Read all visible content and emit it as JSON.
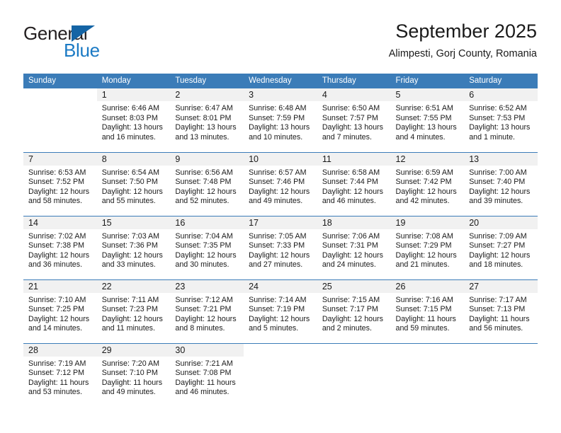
{
  "brand": {
    "line1": "General",
    "line2": "Blue",
    "triangle_color": "#1464a5",
    "blue_text_color": "#1b7ac4"
  },
  "header": {
    "title": "September 2025",
    "subtitle": "Alimpesti, Gorj County, Romania"
  },
  "theme": {
    "header_row_bg": "#3b7cb8",
    "daynum_bg": "#f1f1f1",
    "row_divider": "#3b7cb8",
    "text": "#1a1a1a"
  },
  "weekday_headers": [
    "Sunday",
    "Monday",
    "Tuesday",
    "Wednesday",
    "Thursday",
    "Friday",
    "Saturday"
  ],
  "labels": {
    "sunrise_prefix": "Sunrise:",
    "sunset_prefix": "Sunset:",
    "daylight_prefix": "Daylight:"
  },
  "weeks": [
    [
      {
        "day": "",
        "sunrise": "",
        "sunset": "",
        "daylight_line1": "",
        "daylight_line2": "",
        "blank": true
      },
      {
        "day": "1",
        "sunrise": "Sunrise: 6:46 AM",
        "sunset": "Sunset: 8:03 PM",
        "daylight_line1": "Daylight: 13 hours",
        "daylight_line2": "and 16 minutes."
      },
      {
        "day": "2",
        "sunrise": "Sunrise: 6:47 AM",
        "sunset": "Sunset: 8:01 PM",
        "daylight_line1": "Daylight: 13 hours",
        "daylight_line2": "and 13 minutes."
      },
      {
        "day": "3",
        "sunrise": "Sunrise: 6:48 AM",
        "sunset": "Sunset: 7:59 PM",
        "daylight_line1": "Daylight: 13 hours",
        "daylight_line2": "and 10 minutes."
      },
      {
        "day": "4",
        "sunrise": "Sunrise: 6:50 AM",
        "sunset": "Sunset: 7:57 PM",
        "daylight_line1": "Daylight: 13 hours",
        "daylight_line2": "and 7 minutes."
      },
      {
        "day": "5",
        "sunrise": "Sunrise: 6:51 AM",
        "sunset": "Sunset: 7:55 PM",
        "daylight_line1": "Daylight: 13 hours",
        "daylight_line2": "and 4 minutes."
      },
      {
        "day": "6",
        "sunrise": "Sunrise: 6:52 AM",
        "sunset": "Sunset: 7:53 PM",
        "daylight_line1": "Daylight: 13 hours",
        "daylight_line2": "and 1 minute."
      }
    ],
    [
      {
        "day": "7",
        "sunrise": "Sunrise: 6:53 AM",
        "sunset": "Sunset: 7:52 PM",
        "daylight_line1": "Daylight: 12 hours",
        "daylight_line2": "and 58 minutes."
      },
      {
        "day": "8",
        "sunrise": "Sunrise: 6:54 AM",
        "sunset": "Sunset: 7:50 PM",
        "daylight_line1": "Daylight: 12 hours",
        "daylight_line2": "and 55 minutes."
      },
      {
        "day": "9",
        "sunrise": "Sunrise: 6:56 AM",
        "sunset": "Sunset: 7:48 PM",
        "daylight_line1": "Daylight: 12 hours",
        "daylight_line2": "and 52 minutes."
      },
      {
        "day": "10",
        "sunrise": "Sunrise: 6:57 AM",
        "sunset": "Sunset: 7:46 PM",
        "daylight_line1": "Daylight: 12 hours",
        "daylight_line2": "and 49 minutes."
      },
      {
        "day": "11",
        "sunrise": "Sunrise: 6:58 AM",
        "sunset": "Sunset: 7:44 PM",
        "daylight_line1": "Daylight: 12 hours",
        "daylight_line2": "and 46 minutes."
      },
      {
        "day": "12",
        "sunrise": "Sunrise: 6:59 AM",
        "sunset": "Sunset: 7:42 PM",
        "daylight_line1": "Daylight: 12 hours",
        "daylight_line2": "and 42 minutes."
      },
      {
        "day": "13",
        "sunrise": "Sunrise: 7:00 AM",
        "sunset": "Sunset: 7:40 PM",
        "daylight_line1": "Daylight: 12 hours",
        "daylight_line2": "and 39 minutes."
      }
    ],
    [
      {
        "day": "14",
        "sunrise": "Sunrise: 7:02 AM",
        "sunset": "Sunset: 7:38 PM",
        "daylight_line1": "Daylight: 12 hours",
        "daylight_line2": "and 36 minutes."
      },
      {
        "day": "15",
        "sunrise": "Sunrise: 7:03 AM",
        "sunset": "Sunset: 7:36 PM",
        "daylight_line1": "Daylight: 12 hours",
        "daylight_line2": "and 33 minutes."
      },
      {
        "day": "16",
        "sunrise": "Sunrise: 7:04 AM",
        "sunset": "Sunset: 7:35 PM",
        "daylight_line1": "Daylight: 12 hours",
        "daylight_line2": "and 30 minutes."
      },
      {
        "day": "17",
        "sunrise": "Sunrise: 7:05 AM",
        "sunset": "Sunset: 7:33 PM",
        "daylight_line1": "Daylight: 12 hours",
        "daylight_line2": "and 27 minutes."
      },
      {
        "day": "18",
        "sunrise": "Sunrise: 7:06 AM",
        "sunset": "Sunset: 7:31 PM",
        "daylight_line1": "Daylight: 12 hours",
        "daylight_line2": "and 24 minutes."
      },
      {
        "day": "19",
        "sunrise": "Sunrise: 7:08 AM",
        "sunset": "Sunset: 7:29 PM",
        "daylight_line1": "Daylight: 12 hours",
        "daylight_line2": "and 21 minutes."
      },
      {
        "day": "20",
        "sunrise": "Sunrise: 7:09 AM",
        "sunset": "Sunset: 7:27 PM",
        "daylight_line1": "Daylight: 12 hours",
        "daylight_line2": "and 18 minutes."
      }
    ],
    [
      {
        "day": "21",
        "sunrise": "Sunrise: 7:10 AM",
        "sunset": "Sunset: 7:25 PM",
        "daylight_line1": "Daylight: 12 hours",
        "daylight_line2": "and 14 minutes."
      },
      {
        "day": "22",
        "sunrise": "Sunrise: 7:11 AM",
        "sunset": "Sunset: 7:23 PM",
        "daylight_line1": "Daylight: 12 hours",
        "daylight_line2": "and 11 minutes."
      },
      {
        "day": "23",
        "sunrise": "Sunrise: 7:12 AM",
        "sunset": "Sunset: 7:21 PM",
        "daylight_line1": "Daylight: 12 hours",
        "daylight_line2": "and 8 minutes."
      },
      {
        "day": "24",
        "sunrise": "Sunrise: 7:14 AM",
        "sunset": "Sunset: 7:19 PM",
        "daylight_line1": "Daylight: 12 hours",
        "daylight_line2": "and 5 minutes."
      },
      {
        "day": "25",
        "sunrise": "Sunrise: 7:15 AM",
        "sunset": "Sunset: 7:17 PM",
        "daylight_line1": "Daylight: 12 hours",
        "daylight_line2": "and 2 minutes."
      },
      {
        "day": "26",
        "sunrise": "Sunrise: 7:16 AM",
        "sunset": "Sunset: 7:15 PM",
        "daylight_line1": "Daylight: 11 hours",
        "daylight_line2": "and 59 minutes."
      },
      {
        "day": "27",
        "sunrise": "Sunrise: 7:17 AM",
        "sunset": "Sunset: 7:13 PM",
        "daylight_line1": "Daylight: 11 hours",
        "daylight_line2": "and 56 minutes."
      }
    ],
    [
      {
        "day": "28",
        "sunrise": "Sunrise: 7:19 AM",
        "sunset": "Sunset: 7:12 PM",
        "daylight_line1": "Daylight: 11 hours",
        "daylight_line2": "and 53 minutes."
      },
      {
        "day": "29",
        "sunrise": "Sunrise: 7:20 AM",
        "sunset": "Sunset: 7:10 PM",
        "daylight_line1": "Daylight: 11 hours",
        "daylight_line2": "and 49 minutes."
      },
      {
        "day": "30",
        "sunrise": "Sunrise: 7:21 AM",
        "sunset": "Sunset: 7:08 PM",
        "daylight_line1": "Daylight: 11 hours",
        "daylight_line2": "and 46 minutes."
      },
      {
        "day": "",
        "sunrise": "",
        "sunset": "",
        "daylight_line1": "",
        "daylight_line2": "",
        "blank": true
      },
      {
        "day": "",
        "sunrise": "",
        "sunset": "",
        "daylight_line1": "",
        "daylight_line2": "",
        "blank": true
      },
      {
        "day": "",
        "sunrise": "",
        "sunset": "",
        "daylight_line1": "",
        "daylight_line2": "",
        "blank": true
      },
      {
        "day": "",
        "sunrise": "",
        "sunset": "",
        "daylight_line1": "",
        "daylight_line2": "",
        "blank": true
      }
    ]
  ]
}
